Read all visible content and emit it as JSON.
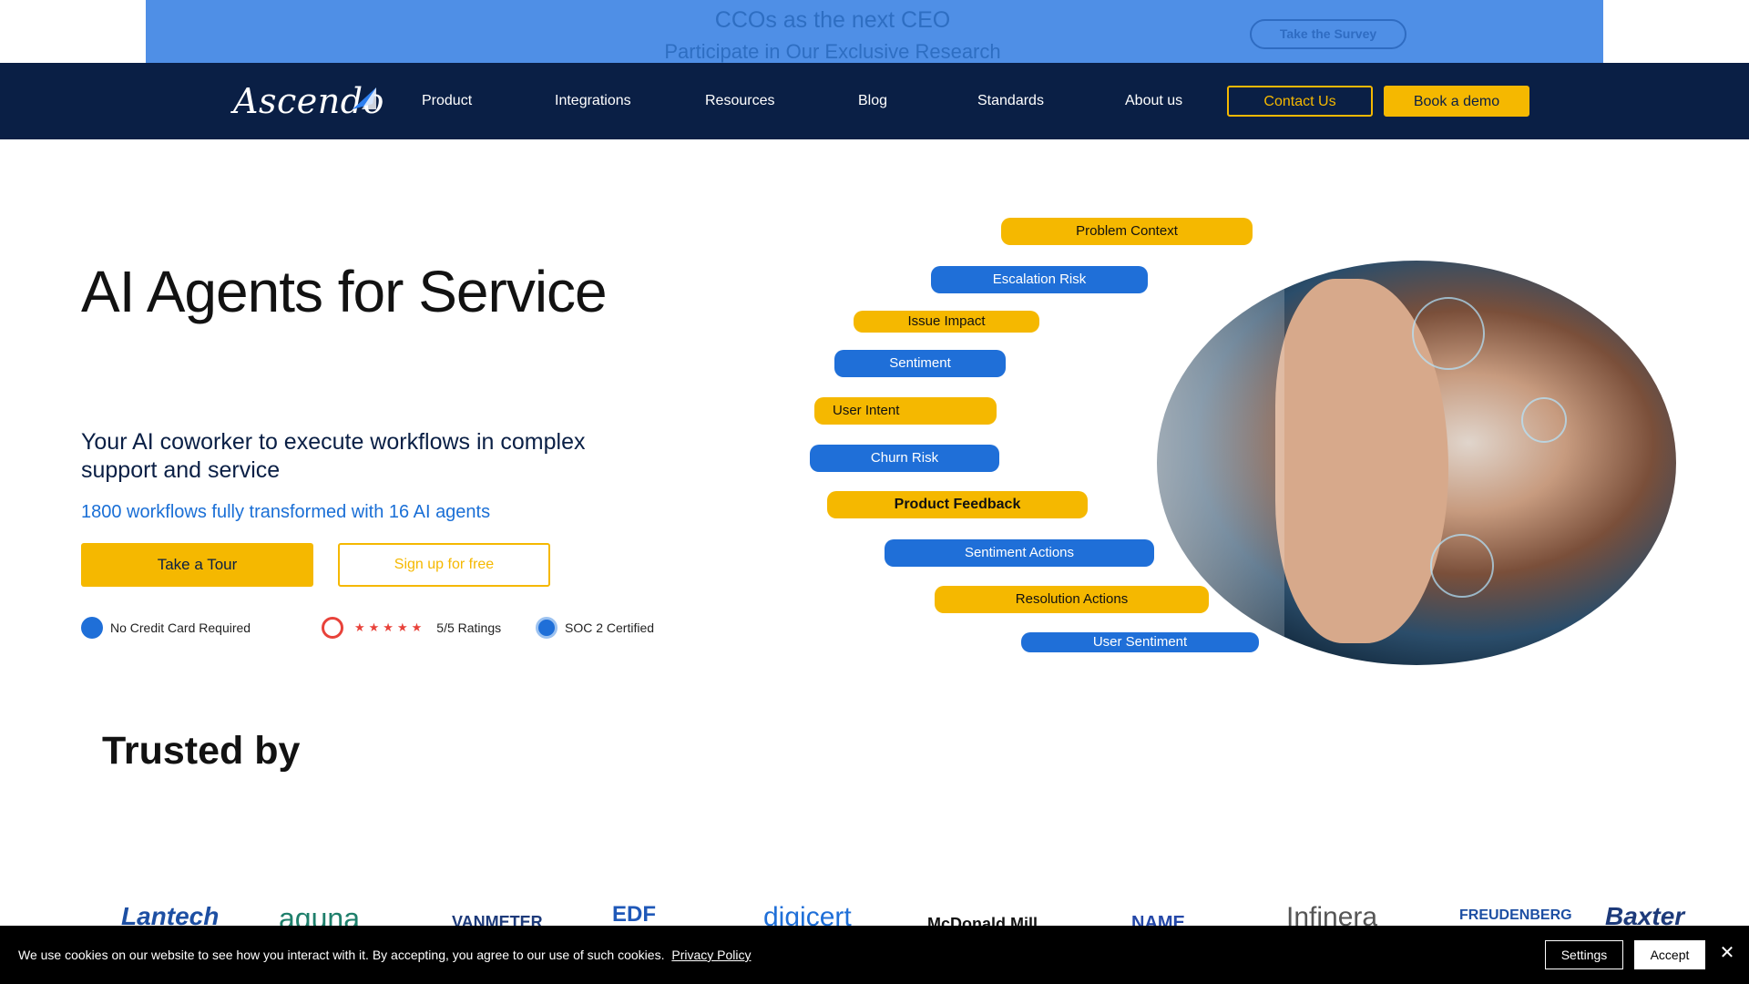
{
  "promo": {
    "title": "CCOs as the next CEO",
    "subtitle": "Participate in Our Exclusive Research",
    "cta": "Take the Survey"
  },
  "nav": {
    "logo": "Ascendo",
    "links": [
      "Product",
      "Integrations",
      "Resources",
      "Blog",
      "Standards",
      "About us"
    ],
    "contact": "Contact Us",
    "demo": "Book a demo"
  },
  "hero": {
    "title": "AI Agents for Service",
    "subtitle": "Your AI coworker to execute workflows in complex support and service",
    "stat": "1800 workflows fully transformed with 16 AI agents",
    "tour": "Take a Tour",
    "signup": "Sign up for free",
    "badges": {
      "card": "No Credit Card Required",
      "ratings": "5/5 Ratings",
      "soc": "SOC 2 Certified"
    },
    "stars": "★★★★★"
  },
  "agents": [
    "Problem Context",
    "Escalation Risk",
    "Issue Impact",
    "Sentiment",
    "User Intent",
    "Churn Risk",
    "Product Feedback",
    "Sentiment Actions",
    "Resolution Actions",
    "User Sentiment"
  ],
  "trusted": {
    "title": "Trusted by",
    "logos": [
      "Lantech",
      "aquna",
      "VANMETER",
      "EDF",
      "digicert",
      "McDonald Mill",
      "NAME",
      "Infinera",
      "FREUDENBERG",
      "Baxter"
    ]
  },
  "cookie": {
    "text": "We use cookies on our website to see how you interact with it. By accepting, you agree to our use of such cookies.",
    "link": "Privacy Policy",
    "settings": "Settings",
    "accept": "Accept"
  },
  "colors": {
    "navy": "#0a1f45",
    "yellow": "#f5b800",
    "blue": "#1f6fd8",
    "promo": "#4f8fe6"
  }
}
